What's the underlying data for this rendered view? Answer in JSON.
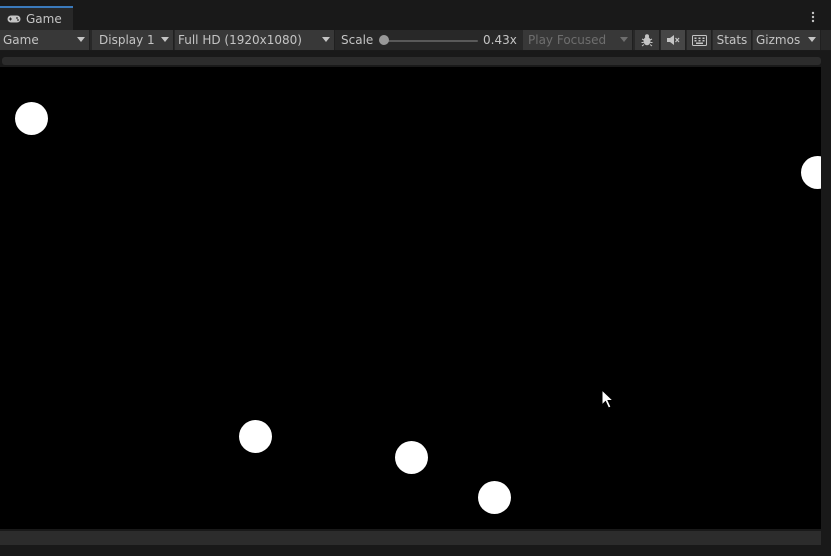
{
  "tab": {
    "title": "Game",
    "icon": "gamepad-icon"
  },
  "menu": {
    "icon": "kebab-menu-icon"
  },
  "toolbar": {
    "view_mode": "Game",
    "display": "Display 1",
    "resolution": "Full HD (1920x1080)",
    "scale_label": "Scale",
    "scale_value": "0.43x",
    "scale_fraction": 0.0,
    "play_mode": "Play Focused",
    "stats_label": "Stats",
    "gizmos_label": "Gizmos",
    "icons": [
      "bug-icon",
      "mute-audio-icon",
      "keyboard-icon"
    ]
  },
  "colors": {
    "background": "#191919",
    "toolbar": "#282828",
    "control": "#383838",
    "accent": "#3a79bb",
    "game_bg": "#000000",
    "ball": "#ffffff"
  }
}
